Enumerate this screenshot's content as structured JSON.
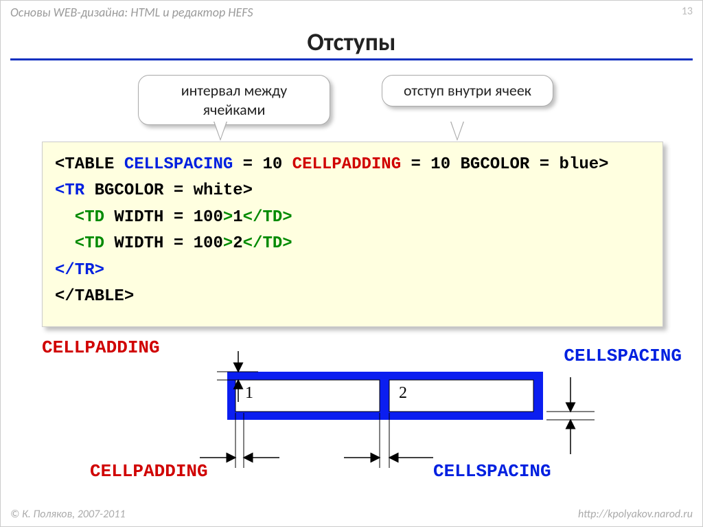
{
  "header": {
    "course": "Основы WEB-дизайна: HTML и редактор HEFS",
    "page": "13"
  },
  "title": "Отступы",
  "callouts": {
    "cellspacing_label": "интервал между ячейками",
    "cellpadding_label": "отступ внутри ячеек"
  },
  "code": {
    "l1": {
      "open": "<TABLE",
      "attr1": " CELLSPACING",
      "eq1": " = 10",
      "attr2": "  CELLPADDING",
      "eq2": " = 10",
      "attr3": "  BGCOLOR",
      "val3": " = blue>",
      "close": ""
    },
    "l2": {
      "open": "<TR",
      "attr": " BGCOLOR",
      "val": " = white>",
      "close": ""
    },
    "l3": {
      "open": "  <TD",
      "attr": "  WIDTH",
      "val": " = 100",
      "gt": ">",
      "text": "1",
      "close": "</TD>"
    },
    "l4": {
      "open": "  <TD",
      "attr": "  WIDTH",
      "val": " = 100",
      "gt": ">",
      "text": "2",
      "close": "</TD>"
    },
    "l5": {
      "close": "</TR>"
    },
    "l6": {
      "close": "</TABLE>"
    }
  },
  "diagram": {
    "cell1_text": "1",
    "cell2_text": "2",
    "labels": {
      "cellpadding": "CELLPADDING",
      "cellspacing": "CELLSPACING"
    }
  },
  "footer": {
    "copyright": "© К. Поляков, 2007-2011",
    "url": "http://kpolyakov.narod.ru"
  }
}
